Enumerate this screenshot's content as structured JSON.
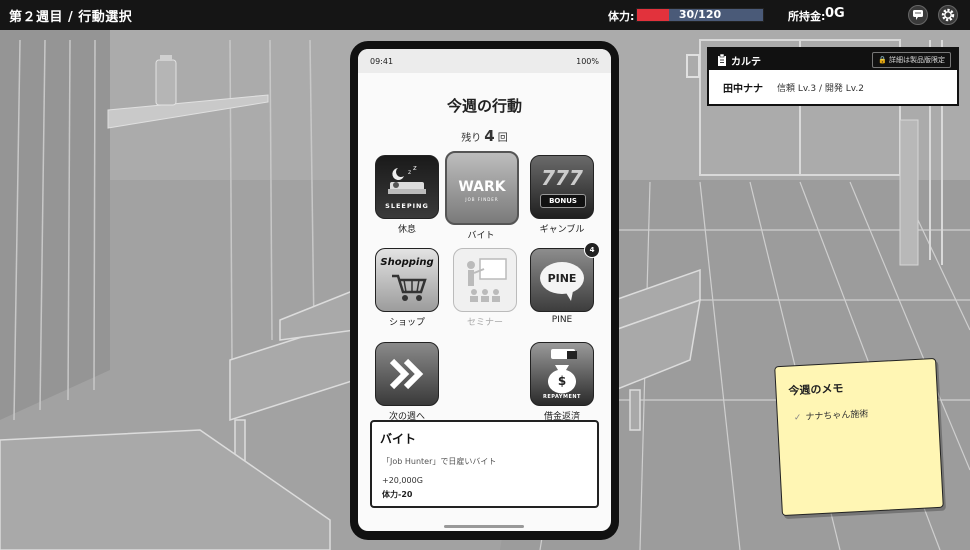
{
  "topbar": {
    "title": "第２週目 / 行動選択",
    "hp_label": "体力:",
    "hp_current": 30,
    "hp_max": 120,
    "hp_text": "30/120",
    "money_label": "所持金:",
    "money_value": "0G",
    "chat_icon": "chat-bubble-icon",
    "settings_icon": "gear-icon"
  },
  "phone": {
    "status_time": "09:41",
    "status_battery": "100%",
    "title": "今週の行動",
    "remaining_prefix": "残り",
    "remaining_count": "4",
    "remaining_suffix": "回",
    "apps": [
      {
        "label": "休息",
        "icon_text": "SLEEPING",
        "icon": "sleeping-icon"
      },
      {
        "label": "バイト",
        "icon_text": "WARK",
        "icon_sub": "JOB FINDER",
        "icon": "wark-job-finder-icon"
      },
      {
        "label": "ギャンブル",
        "icon_text": "777",
        "icon_sub": "BONUS",
        "icon": "slot-bonus-icon"
      },
      {
        "label": "ショップ",
        "icon_text": "Shopping",
        "icon": "shopping-cart-icon"
      },
      {
        "label": "セミナー",
        "icon": "seminar-icon",
        "disabled": true
      },
      {
        "label": "PINE",
        "icon_text": "PINE",
        "icon": "pine-chat-icon",
        "badge": "4"
      },
      {
        "label": "次の週へ",
        "icon": "next-week-chevrons-icon"
      },
      {
        "label": "借金返済",
        "icon_text": "REPAYMENT",
        "icon": "repayment-money-bag-icon"
      }
    ],
    "detail": {
      "title": "バイト",
      "desc": "「Job Hunter」で日雇いバイト",
      "money": "+20,000G",
      "hp_label": "体力",
      "hp_value": "-20"
    }
  },
  "karte": {
    "title": "カルテ",
    "lock_text": "詳細は製品版限定",
    "name": "田中ナナ",
    "trust": "信頼 Lv.3",
    "sep": "/",
    "dev": "開発 Lv.2"
  },
  "memo": {
    "title": "今週のメモ",
    "items": [
      "ナナちゃん施術"
    ]
  }
}
